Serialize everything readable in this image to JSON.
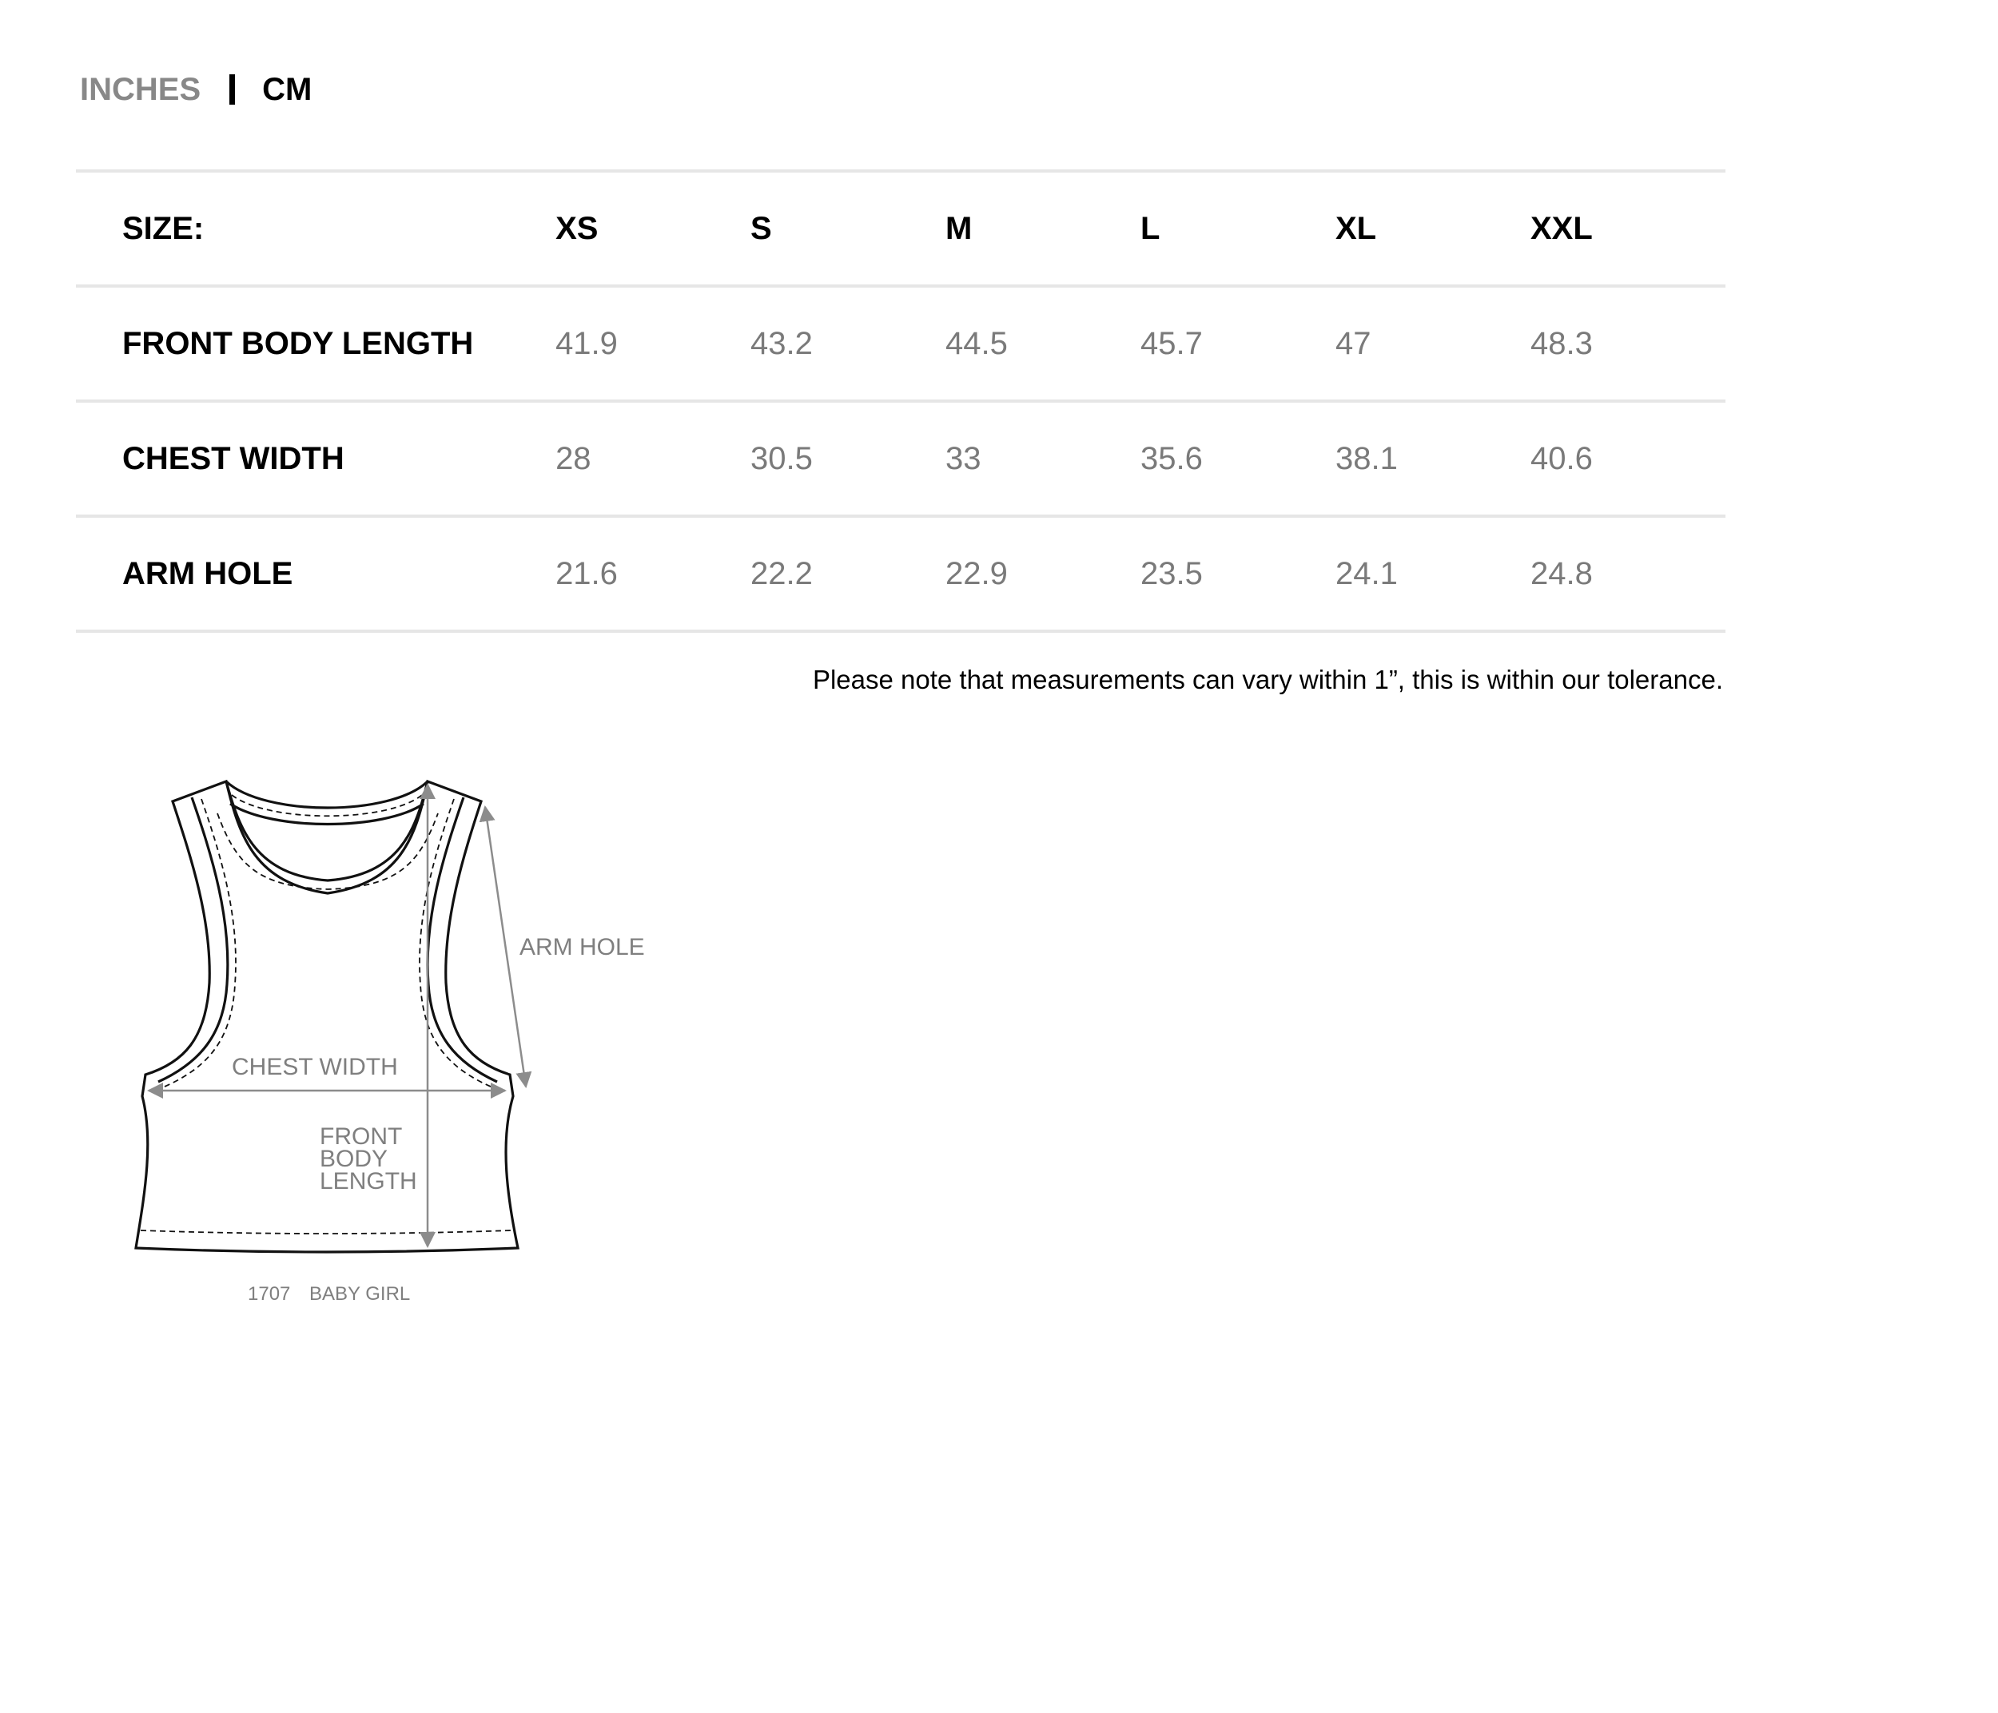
{
  "units": {
    "inches_label": "INCHES",
    "cm_label": "CM",
    "active": "CM"
  },
  "table": {
    "header_label": "SIZE:",
    "sizes": [
      "XS",
      "S",
      "M",
      "L",
      "XL",
      "XXL"
    ],
    "rows": [
      {
        "label": "FRONT BODY LENGTH",
        "values": [
          "41.9",
          "43.2",
          "44.5",
          "45.7",
          "47",
          "48.3"
        ]
      },
      {
        "label": "CHEST WIDTH",
        "values": [
          "28",
          "30.5",
          "33",
          "35.6",
          "38.1",
          "40.6"
        ]
      },
      {
        "label": "ARM HOLE",
        "values": [
          "21.6",
          "22.2",
          "22.9",
          "23.5",
          "24.1",
          "24.8"
        ]
      }
    ]
  },
  "note": "Please note that measurements can vary within 1”, this is within our tolerance.",
  "diagram": {
    "arm_hole_label": "ARM HOLE",
    "chest_width_label": "CHEST WIDTH",
    "front_body_length_lines": [
      "FRONT",
      "BODY",
      "LENGTH"
    ],
    "style_number": "1707",
    "style_name": "BABY GIRL"
  },
  "colors": {
    "muted_text": "#7a7a7a",
    "divider": "#e6e6e6",
    "measure_lines": "#8c8c8c"
  }
}
